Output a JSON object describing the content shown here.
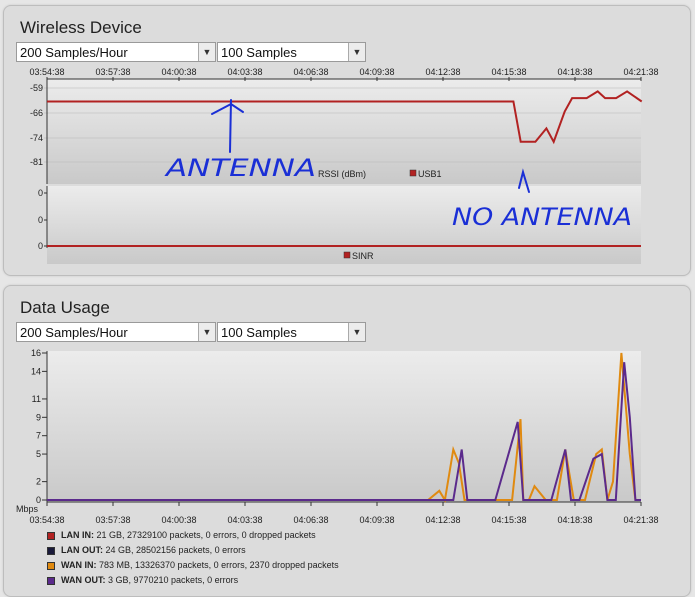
{
  "wireless": {
    "title": "Wireless Device",
    "rate_select": "200 Samples/Hour",
    "count_select": "100 Samples",
    "time_ticks": [
      "03:54:38",
      "03:57:38",
      "04:00:38",
      "04:03:38",
      "04:06:38",
      "04:09:38",
      "04:12:38",
      "04:15:38",
      "04:18:38",
      "04:21:38"
    ],
    "rssi_ticks": [
      "-59",
      "-66",
      "-74",
      "-81"
    ],
    "rssi_legend_label": "RSSI (dBm)",
    "rssi_series_name": "USB1",
    "sinr_ticks": [
      "0",
      "0",
      "0"
    ],
    "sinr_series_name": "SINR",
    "annotation_left": "ANTENNA",
    "annotation_right": "NO ANTENNA"
  },
  "data_usage": {
    "title": "Data Usage",
    "rate_select": "200 Samples/Hour",
    "count_select": "100 Samples",
    "y_ticks": [
      "16",
      "14",
      "11",
      "9",
      "7",
      "5",
      "2",
      "0"
    ],
    "y_unit": "Mbps",
    "time_ticks": [
      "03:54:38",
      "03:57:38",
      "04:00:38",
      "04:03:38",
      "04:06:38",
      "04:09:38",
      "04:12:38",
      "04:15:38",
      "04:18:38",
      "04:21:38"
    ],
    "legend": [
      {
        "label": "LAN IN:",
        "detail": "21 GB, 27329100 packets, 0 errors, 0 dropped packets",
        "color": "#b22222"
      },
      {
        "label": "LAN OUT:",
        "detail": "24 GB, 28502156 packets, 0 errors",
        "color": "#1a1a3a"
      },
      {
        "label": "WAN IN:",
        "detail": "783 MB, 13326370 packets, 0 errors, 2370 dropped packets",
        "color": "#e08a10"
      },
      {
        "label": "WAN OUT:",
        "detail": "3 GB, 9770210 packets, 0 errors",
        "color": "#5b2a8c"
      }
    ]
  },
  "chart_data": [
    {
      "type": "line",
      "title": "",
      "xlabel": "",
      "ylabel": "RSSI (dBm)",
      "ylim": [
        -81,
        -59
      ],
      "series": [
        {
          "name": "USB1",
          "color": "#b22222",
          "x": [
            "03:54:38",
            "04:15:50",
            "04:16:10",
            "04:16:50",
            "04:17:20",
            "04:17:40",
            "04:18:10",
            "04:18:30",
            "04:19:10",
            "04:19:40",
            "04:20:00",
            "04:20:30",
            "04:21:00",
            "04:21:40"
          ],
          "values": [
            -63,
            -63,
            -75,
            -75,
            -71,
            -75,
            -66,
            -62,
            -62,
            -60,
            -62,
            -62,
            -60,
            -63
          ]
        }
      ]
    },
    {
      "type": "line",
      "title": "",
      "ylabel": "",
      "series": [
        {
          "name": "SINR",
          "color": "#b22222",
          "values": [
            0,
            0
          ]
        }
      ]
    },
    {
      "type": "line",
      "title": "",
      "xlabel": "",
      "ylabel": "Mbps",
      "ylim": [
        0,
        16
      ],
      "series": [
        {
          "name": "WAN IN",
          "color": "#e08a10",
          "x": [
            0,
            13.6,
            14.0,
            14.2,
            14.5,
            14.7,
            14.9,
            15.2,
            15.5,
            16.0,
            16.6,
            16.9,
            17.0,
            17.2,
            17.4,
            17.8,
            18.2,
            18.5,
            18.8,
            19.2,
            19.6,
            19.8,
            20.0,
            20.2,
            20.5,
            20.8,
            21.0,
            21.2
          ],
          "values": [
            0,
            0,
            1,
            0,
            5.5,
            4,
            0,
            0,
            0,
            0,
            0,
            8.8,
            0,
            0,
            1.5,
            0,
            0,
            5.5,
            0,
            0,
            5,
            5.5,
            0,
            2,
            16,
            5,
            0,
            0
          ]
        },
        {
          "name": "WAN OUT",
          "color": "#5b2a8c",
          "x": [
            0,
            14.0,
            14.5,
            14.8,
            15.0,
            15.5,
            16.0,
            16.8,
            17.0,
            17.5,
            18.0,
            18.5,
            18.7,
            19.0,
            19.5,
            19.8,
            20.0,
            20.3,
            20.6,
            20.8,
            21.0,
            21.2
          ],
          "values": [
            0,
            0,
            0,
            5.5,
            0,
            0,
            0,
            8.5,
            0,
            0,
            0,
            5.5,
            0,
            0,
            4.5,
            5,
            0,
            0,
            15,
            9,
            0,
            0
          ]
        }
      ]
    }
  ]
}
